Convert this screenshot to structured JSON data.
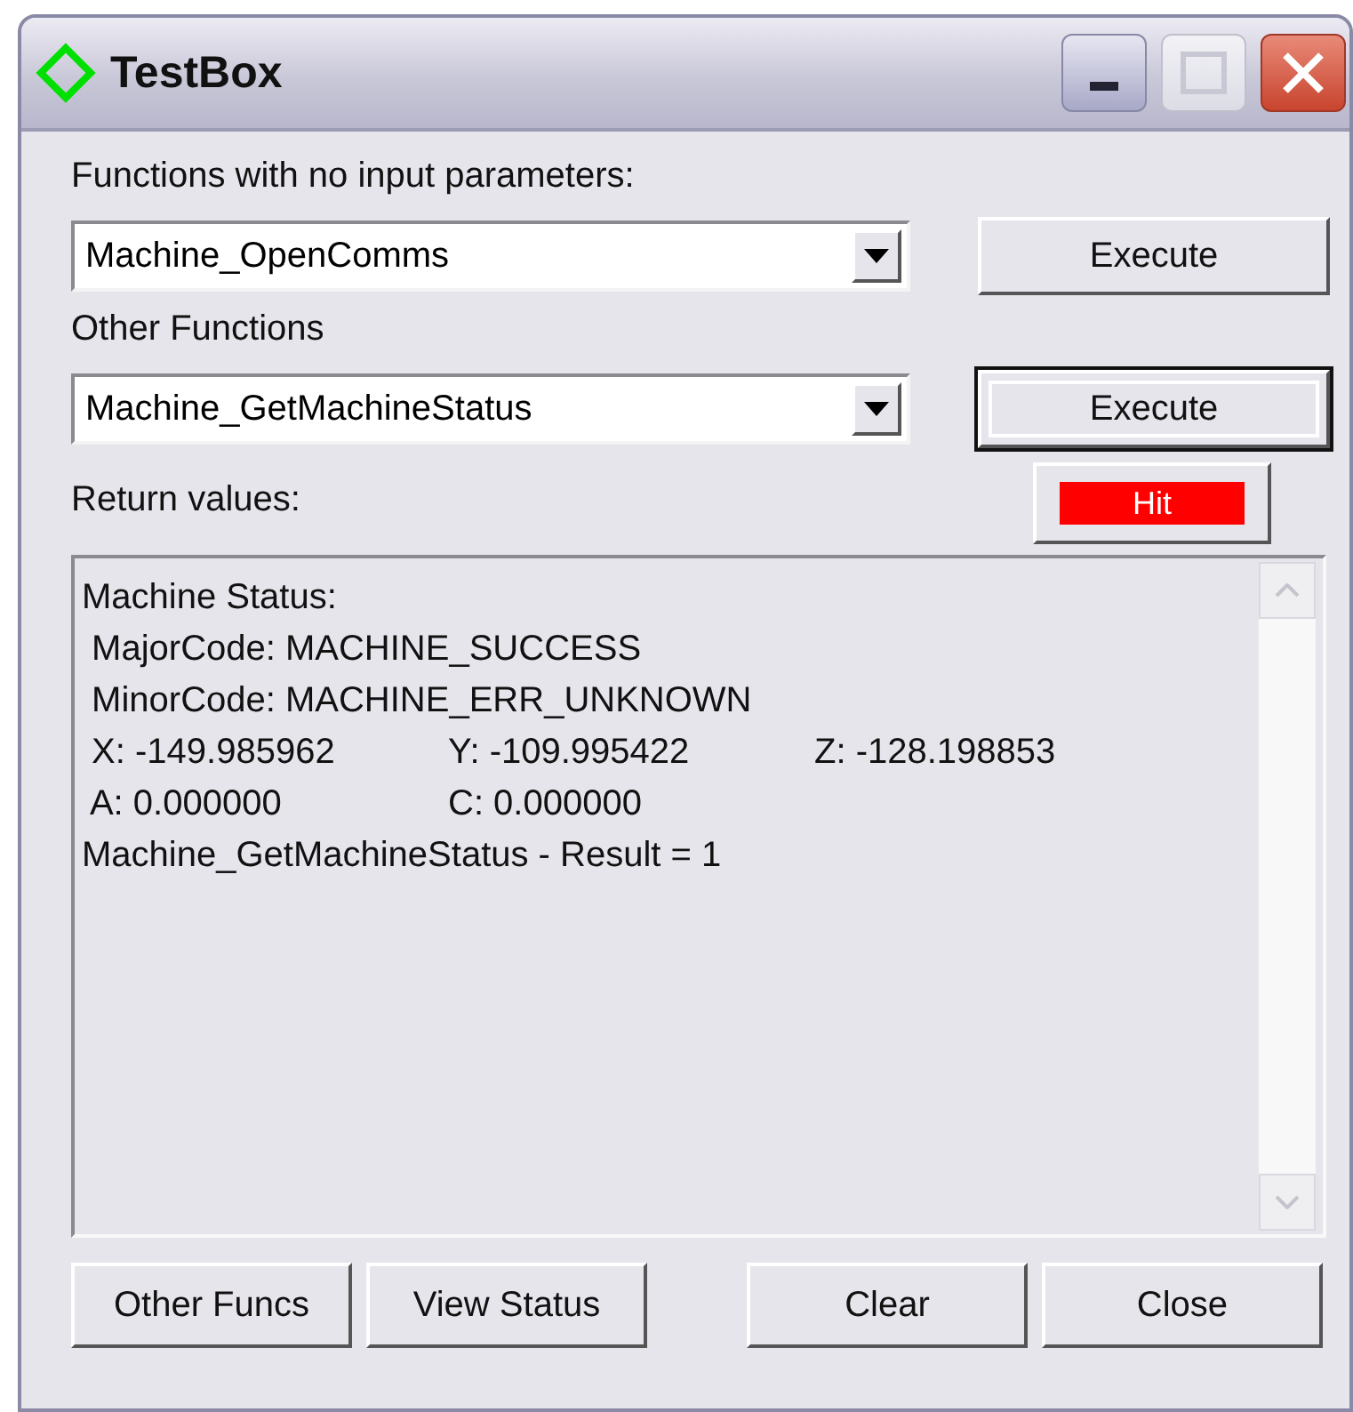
{
  "window": {
    "title": "TestBox"
  },
  "no_param_functions": {
    "label": "Functions with no input parameters:",
    "value": "Machine_OpenComms",
    "button": {
      "label": "Execute",
      "default": false
    }
  },
  "other_functions": {
    "label": "Other Functions",
    "value": "Machine_GetMachineStatus",
    "button": {
      "label": "Execute",
      "default": true
    }
  },
  "return_values": {
    "label": "Return values:",
    "indicator": {
      "label": "Hit",
      "on": true
    },
    "lines": [
      {
        "cells": [
          "Machine Status:"
        ]
      },
      {
        "cells": [
          " MajorCode: MACHINE_SUCCESS"
        ]
      },
      {
        "cells": [
          " MinorCode: MACHINE_ERR_UNKNOWN"
        ]
      },
      {
        "cells": [
          " X: -149.985962",
          "Y: -109.995422",
          "Z: -128.198853"
        ]
      },
      {
        "cells": [
          " A: 0.000000",
          "C: 0.000000"
        ]
      },
      {
        "cells": [
          "Machine_GetMachineStatus - Result = 1"
        ]
      }
    ]
  },
  "left_buttons": [
    {
      "label": "Other Funcs"
    },
    {
      "label": "View Status"
    }
  ],
  "right_buttons": [
    {
      "label": "Clear"
    },
    {
      "label": "Close"
    }
  ]
}
